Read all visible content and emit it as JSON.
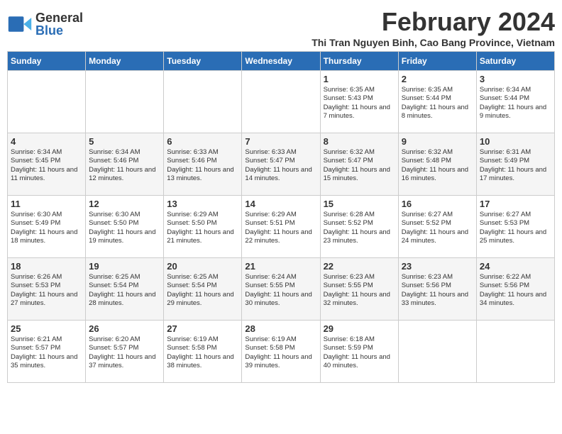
{
  "app": {
    "logo_general": "General",
    "logo_blue": "Blue"
  },
  "header": {
    "month_title": "February 2024",
    "location": "Thi Tran Nguyen Binh, Cao Bang Province, Vietnam"
  },
  "days_of_week": [
    "Sunday",
    "Monday",
    "Tuesday",
    "Wednesday",
    "Thursday",
    "Friday",
    "Saturday"
  ],
  "weeks": [
    [
      {
        "day": "",
        "content": ""
      },
      {
        "day": "",
        "content": ""
      },
      {
        "day": "",
        "content": ""
      },
      {
        "day": "",
        "content": ""
      },
      {
        "day": "1",
        "content": "Sunrise: 6:35 AM\nSunset: 5:43 PM\nDaylight: 11 hours and 7 minutes."
      },
      {
        "day": "2",
        "content": "Sunrise: 6:35 AM\nSunset: 5:44 PM\nDaylight: 11 hours and 8 minutes."
      },
      {
        "day": "3",
        "content": "Sunrise: 6:34 AM\nSunset: 5:44 PM\nDaylight: 11 hours and 9 minutes."
      }
    ],
    [
      {
        "day": "4",
        "content": "Sunrise: 6:34 AM\nSunset: 5:45 PM\nDaylight: 11 hours and 11 minutes."
      },
      {
        "day": "5",
        "content": "Sunrise: 6:34 AM\nSunset: 5:46 PM\nDaylight: 11 hours and 12 minutes."
      },
      {
        "day": "6",
        "content": "Sunrise: 6:33 AM\nSunset: 5:46 PM\nDaylight: 11 hours and 13 minutes."
      },
      {
        "day": "7",
        "content": "Sunrise: 6:33 AM\nSunset: 5:47 PM\nDaylight: 11 hours and 14 minutes."
      },
      {
        "day": "8",
        "content": "Sunrise: 6:32 AM\nSunset: 5:47 PM\nDaylight: 11 hours and 15 minutes."
      },
      {
        "day": "9",
        "content": "Sunrise: 6:32 AM\nSunset: 5:48 PM\nDaylight: 11 hours and 16 minutes."
      },
      {
        "day": "10",
        "content": "Sunrise: 6:31 AM\nSunset: 5:49 PM\nDaylight: 11 hours and 17 minutes."
      }
    ],
    [
      {
        "day": "11",
        "content": "Sunrise: 6:30 AM\nSunset: 5:49 PM\nDaylight: 11 hours and 18 minutes."
      },
      {
        "day": "12",
        "content": "Sunrise: 6:30 AM\nSunset: 5:50 PM\nDaylight: 11 hours and 19 minutes."
      },
      {
        "day": "13",
        "content": "Sunrise: 6:29 AM\nSunset: 5:50 PM\nDaylight: 11 hours and 21 minutes."
      },
      {
        "day": "14",
        "content": "Sunrise: 6:29 AM\nSunset: 5:51 PM\nDaylight: 11 hours and 22 minutes."
      },
      {
        "day": "15",
        "content": "Sunrise: 6:28 AM\nSunset: 5:52 PM\nDaylight: 11 hours and 23 minutes."
      },
      {
        "day": "16",
        "content": "Sunrise: 6:27 AM\nSunset: 5:52 PM\nDaylight: 11 hours and 24 minutes."
      },
      {
        "day": "17",
        "content": "Sunrise: 6:27 AM\nSunset: 5:53 PM\nDaylight: 11 hours and 25 minutes."
      }
    ],
    [
      {
        "day": "18",
        "content": "Sunrise: 6:26 AM\nSunset: 5:53 PM\nDaylight: 11 hours and 27 minutes."
      },
      {
        "day": "19",
        "content": "Sunrise: 6:25 AM\nSunset: 5:54 PM\nDaylight: 11 hours and 28 minutes."
      },
      {
        "day": "20",
        "content": "Sunrise: 6:25 AM\nSunset: 5:54 PM\nDaylight: 11 hours and 29 minutes."
      },
      {
        "day": "21",
        "content": "Sunrise: 6:24 AM\nSunset: 5:55 PM\nDaylight: 11 hours and 30 minutes."
      },
      {
        "day": "22",
        "content": "Sunrise: 6:23 AM\nSunset: 5:55 PM\nDaylight: 11 hours and 32 minutes."
      },
      {
        "day": "23",
        "content": "Sunrise: 6:23 AM\nSunset: 5:56 PM\nDaylight: 11 hours and 33 minutes."
      },
      {
        "day": "24",
        "content": "Sunrise: 6:22 AM\nSunset: 5:56 PM\nDaylight: 11 hours and 34 minutes."
      }
    ],
    [
      {
        "day": "25",
        "content": "Sunrise: 6:21 AM\nSunset: 5:57 PM\nDaylight: 11 hours and 35 minutes."
      },
      {
        "day": "26",
        "content": "Sunrise: 6:20 AM\nSunset: 5:57 PM\nDaylight: 11 hours and 37 minutes."
      },
      {
        "day": "27",
        "content": "Sunrise: 6:19 AM\nSunset: 5:58 PM\nDaylight: 11 hours and 38 minutes."
      },
      {
        "day": "28",
        "content": "Sunrise: 6:19 AM\nSunset: 5:58 PM\nDaylight: 11 hours and 39 minutes."
      },
      {
        "day": "29",
        "content": "Sunrise: 6:18 AM\nSunset: 5:59 PM\nDaylight: 11 hours and 40 minutes."
      },
      {
        "day": "",
        "content": ""
      },
      {
        "day": "",
        "content": ""
      }
    ]
  ]
}
